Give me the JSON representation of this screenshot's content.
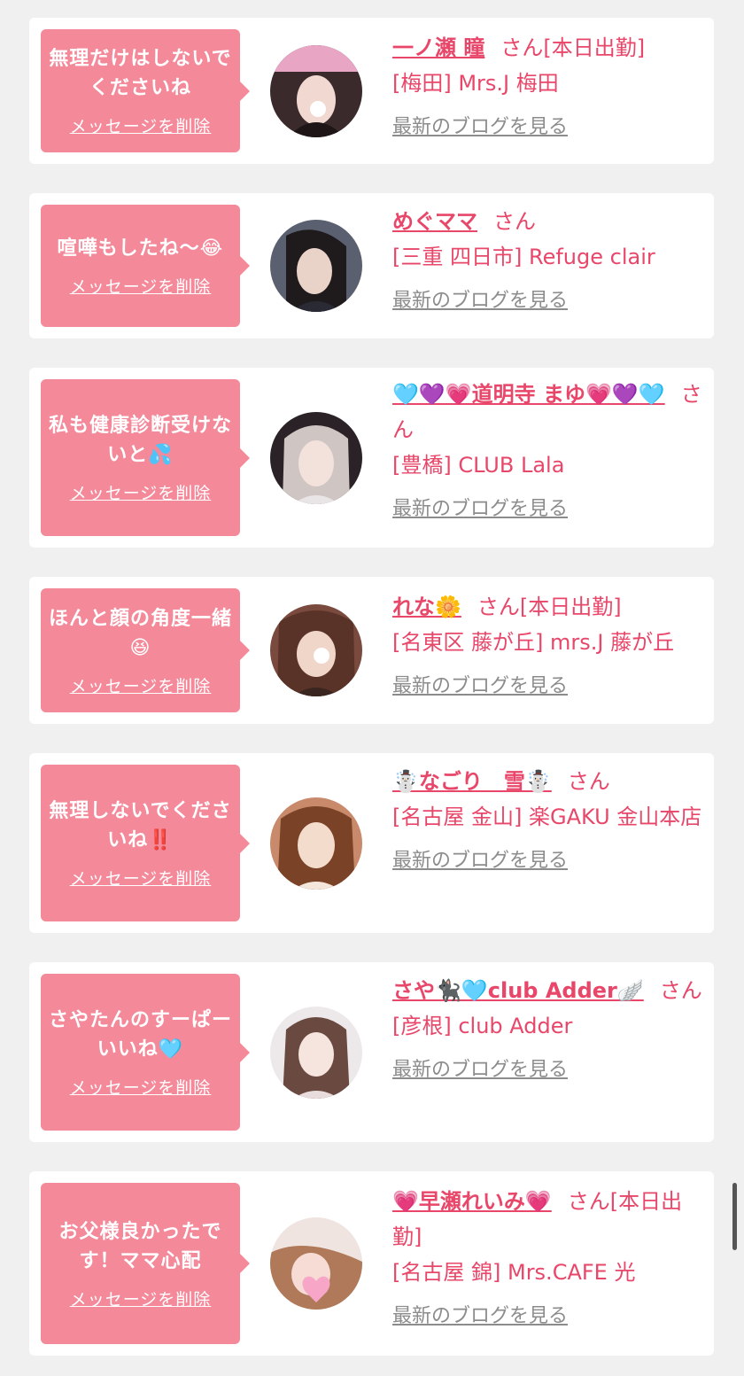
{
  "san_label": "さん",
  "delete_label": "メッセージを削除",
  "blog_label": "最新のブログを見る",
  "colors": {
    "background": "#f0f0f0",
    "card": "#ffffff",
    "bubble": "#f4899a",
    "accent_text": "#e8476a",
    "link_gray": "#8c8c8c"
  },
  "entries": [
    {
      "message": "無理だけはしないでくださいね",
      "name": "一ノ瀬 瞳",
      "status": "[本日出勤]",
      "shop": "[梅田] Mrs.J 梅田",
      "avatar_icon": "woman-portrait-icon"
    },
    {
      "message": "喧嘩もしたね〜😂",
      "name": "めぐママ",
      "status": "",
      "shop": "[三重 四日市] Refuge clair",
      "avatar_icon": "woman-portrait-icon"
    },
    {
      "message": "私も健康診断受けないと💦",
      "name": "🩵💜💗道明寺 まゆ💗💜🩵",
      "status": "",
      "shop": "[豊橋] CLUB Lala",
      "avatar_icon": "woman-portrait-icon"
    },
    {
      "message": "ほんと顔の角度一緒😆",
      "name": "れな🌼",
      "status": "[本日出勤]",
      "shop": "[名東区 藤が丘] mrs.J 藤が丘",
      "avatar_icon": "woman-portrait-icon"
    },
    {
      "message": "無理しないでくださいね‼️",
      "name": "☃️なごり　雪☃️",
      "status": "",
      "shop": "[名古屋 金山] 楽GAKU 金山本店",
      "avatar_icon": "woman-portrait-icon"
    },
    {
      "message": "さやたんのすーぱーいいね🩵",
      "name": "さや🐈‍⬛🩵club Adder🪽",
      "status": "",
      "shop": "[彦根] club Adder",
      "avatar_icon": "woman-portrait-icon"
    },
    {
      "message": "お父様良かったです！ママ心配",
      "name": "💗早瀬れいみ💗",
      "status": "[本日出勤]",
      "shop": "[名古屋 錦] Mrs.CAFE 光",
      "avatar_icon": "woman-portrait-icon"
    }
  ]
}
